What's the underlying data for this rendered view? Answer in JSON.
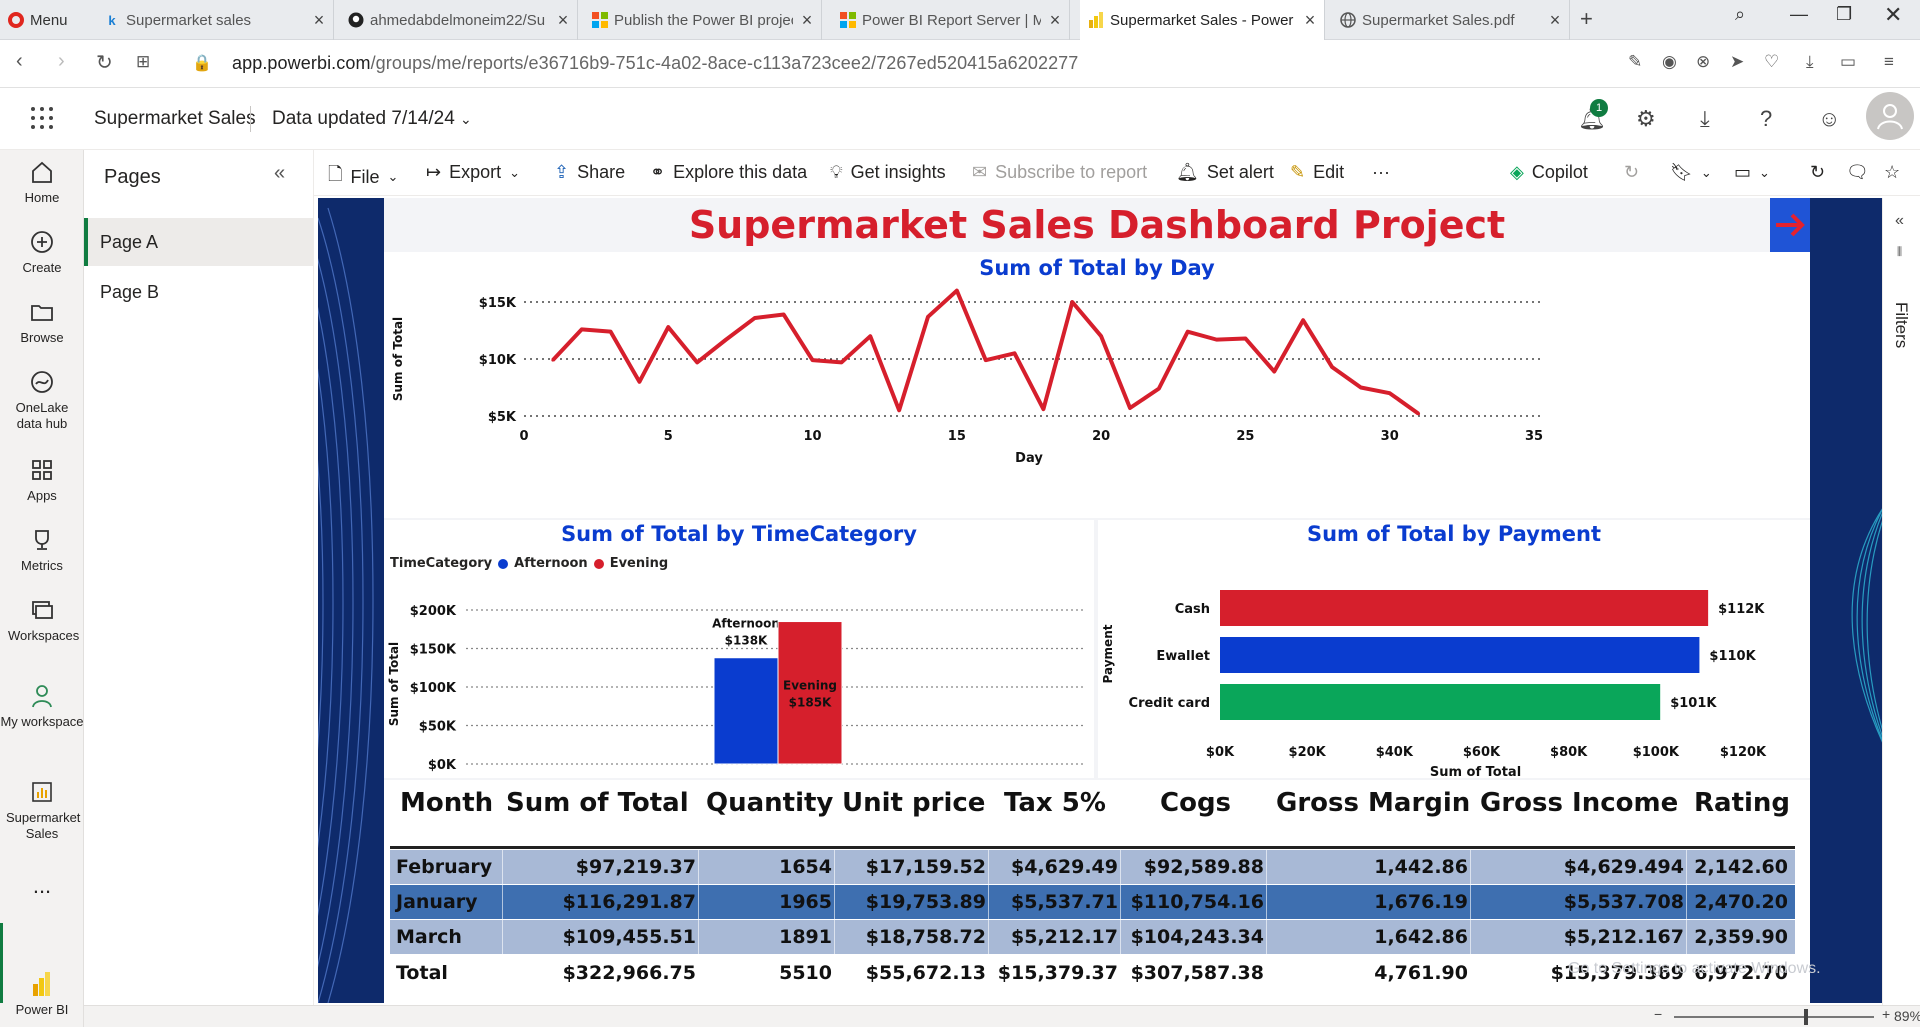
{
  "browser": {
    "menu_label": "Menu",
    "tabs": [
      {
        "title": "Supermarket sales",
        "icon": "k"
      },
      {
        "title": "ahmedabdelmoneim22/Su",
        "icon": "github"
      },
      {
        "title": "Publish the Power BI projec",
        "icon": "ms"
      },
      {
        "title": "Power BI Report Server | Mi",
        "icon": "ms"
      },
      {
        "title": "Supermarket Sales - Power",
        "icon": "pbi"
      },
      {
        "title": "Supermarket Sales.pdf",
        "icon": "globe"
      }
    ],
    "url_host": "app.powerbi.com",
    "url_path": "/groups/me/reports/e36716b9-751c-4a02-8ace-c113a723cee2/7267ed520415a6202277"
  },
  "header": {
    "title": "Supermarket Sales",
    "updated": "Data updated 7/14/24",
    "notification_count": "1"
  },
  "rail": [
    {
      "label": "Home"
    },
    {
      "label": "Create"
    },
    {
      "label": "Browse"
    },
    {
      "label": "OneLake data hub"
    },
    {
      "label": "Apps"
    },
    {
      "label": "Metrics"
    },
    {
      "label": "Workspaces"
    },
    {
      "label": "My workspace"
    },
    {
      "label": "Supermarket Sales"
    },
    {
      "label": "..."
    },
    {
      "label": "Power BI"
    }
  ],
  "pages": {
    "title": "Pages",
    "items": [
      "Page A",
      "Page B"
    ]
  },
  "actions": {
    "file": "File",
    "export": "Export",
    "share": "Share",
    "explore": "Explore this data",
    "insights": "Get insights",
    "subscribe": "Subscribe to report",
    "alert": "Set alert",
    "edit": "Edit",
    "more": "···",
    "copilot": "Copilot"
  },
  "report": {
    "title": "Supermarket Sales Dashboard Project"
  },
  "filters": {
    "label": "Filters"
  },
  "status": {
    "zoom": "89%",
    "watermark": "Go to Settings to activate Windows."
  },
  "chart_data": [
    {
      "type": "line",
      "title": "Sum of Total by Day",
      "xlabel": "Day",
      "ylabel": "Sum of Total",
      "xlim": [
        0,
        35
      ],
      "xticks": [
        0,
        5,
        10,
        15,
        20,
        25,
        30,
        35
      ],
      "ylim": [
        5000,
        15000
      ],
      "yticks": [
        {
          "v": 15000,
          "label": "$15K"
        },
        {
          "v": 10000,
          "label": "$10K"
        },
        {
          "v": 5000,
          "label": "$5K"
        }
      ],
      "color": "#d61f2c",
      "x": [
        1,
        2,
        3,
        4,
        5,
        6,
        7,
        8,
        9,
        10,
        11,
        12,
        13,
        14,
        15,
        16,
        17,
        18,
        19,
        20,
        21,
        22,
        23,
        24,
        25,
        26,
        27,
        28,
        29,
        30,
        31
      ],
      "y": [
        9900,
        12600,
        12400,
        8000,
        12800,
        9700,
        11700,
        13600,
        13900,
        9900,
        9700,
        12000,
        5500,
        13700,
        16000,
        9900,
        10500,
        5600,
        15000,
        12000,
        5700,
        7400,
        12400,
        11700,
        11800,
        8900,
        13400,
        9300,
        7500,
        7000,
        5200
      ]
    },
    {
      "type": "bar",
      "title": "Sum of Total by TimeCategory",
      "legend_title": "TimeCategory",
      "ylabel": "Sum of Total",
      "ylim": [
        0,
        200000
      ],
      "yticks": [
        {
          "v": 200000,
          "label": "$200K"
        },
        {
          "v": 150000,
          "label": "$150K"
        },
        {
          "v": 100000,
          "label": "$100K"
        },
        {
          "v": 50000,
          "label": "$50K"
        },
        {
          "v": 0,
          "label": "$0K"
        }
      ],
      "series": [
        {
          "name": "Afternoon",
          "value": 138000,
          "label": "$138K",
          "color": "#0a3ccf"
        },
        {
          "name": "Evening",
          "value": 185000,
          "label": "$185K",
          "color": "#d61f2c"
        }
      ]
    },
    {
      "type": "bar",
      "orientation": "horizontal",
      "title": "Sum of Total by Payment",
      "xlabel": "Sum of Total",
      "ylabel": "Payment",
      "xlim": [
        0,
        120000
      ],
      "xticks": [
        {
          "v": 0,
          "label": "$0K"
        },
        {
          "v": 20000,
          "label": "$20K"
        },
        {
          "v": 40000,
          "label": "$40K"
        },
        {
          "v": 60000,
          "label": "$60K"
        },
        {
          "v": 80000,
          "label": "$80K"
        },
        {
          "v": 100000,
          "label": "$100K"
        },
        {
          "v": 120000,
          "label": "$120K"
        }
      ],
      "categories": [
        "Cash",
        "Ewallet",
        "Credit card"
      ],
      "values": [
        112000,
        110000,
        101000
      ],
      "labels": [
        "$112K",
        "$110K",
        "$101K"
      ],
      "colors": [
        "#d61f2c",
        "#0a3ccf",
        "#0aa65a"
      ]
    },
    {
      "type": "table",
      "columns": [
        "Month",
        "Sum of Total",
        "Quantity",
        "Unit price",
        "Tax 5%",
        "Cogs",
        "Gross Margin",
        "Gross Income",
        "Rating"
      ],
      "rows": [
        [
          "February",
          "$97,219.37",
          "1654",
          "$17,159.52",
          "$4,629.49",
          "$92,589.88",
          "1,442.86",
          "$4,629.494",
          "2,142.60"
        ],
        [
          "January",
          "$116,291.87",
          "1965",
          "$19,753.89",
          "$5,537.71",
          "$110,754.16",
          "1,676.19",
          "$5,537.708",
          "2,470.20"
        ],
        [
          "March",
          "$109,455.51",
          "1891",
          "$18,758.72",
          "$5,212.17",
          "$104,243.34",
          "1,642.86",
          "$5,212.167",
          "2,359.90"
        ]
      ],
      "total": [
        "Total",
        "$322,966.75",
        "5510",
        "$55,672.13",
        "$15,379.37",
        "$307,587.38",
        "4,761.90",
        "$15,379.369",
        "6,972.70"
      ],
      "row_colors": [
        "#a8b9d6",
        "#3e6fb0",
        "#a8b9d6"
      ]
    }
  ]
}
